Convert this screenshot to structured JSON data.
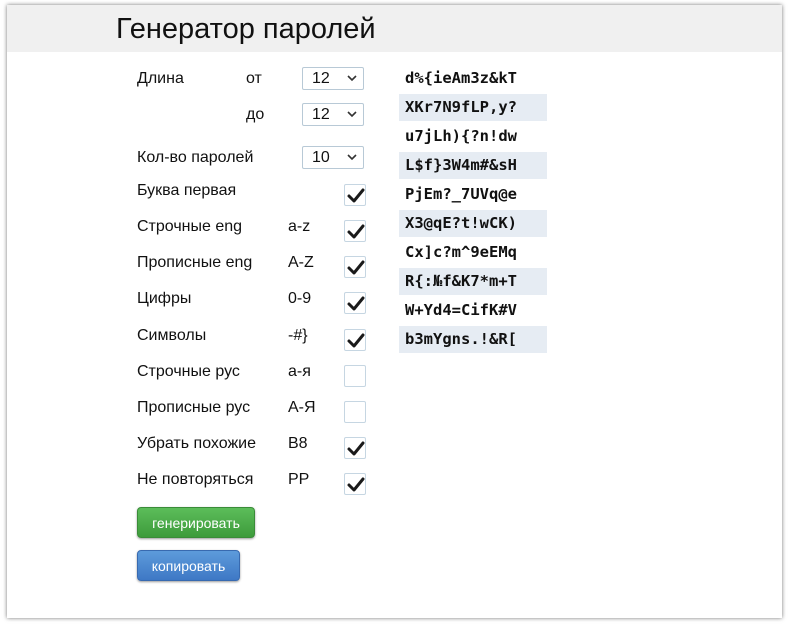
{
  "title": "Генератор паролей",
  "length": {
    "label": "Длина",
    "from_label": "от",
    "from_value": "12",
    "to_label": "до",
    "to_value": "12"
  },
  "count": {
    "label": "Кол-во паролей",
    "value": "10"
  },
  "options": [
    {
      "label": "Буква первая",
      "hint": "",
      "checked": true
    },
    {
      "label": "Строчные eng",
      "hint": "a-z",
      "checked": true
    },
    {
      "label": "Прописные eng",
      "hint": "A-Z",
      "checked": true
    },
    {
      "label": "Цифры",
      "hint": "0-9",
      "checked": true
    },
    {
      "label": "Символы",
      "hint": "-#}",
      "checked": true
    },
    {
      "label": "Строчные рус",
      "hint": "а-я",
      "checked": false
    },
    {
      "label": "Прописные рус",
      "hint": "А-Я",
      "checked": false
    },
    {
      "label": "Убрать похожие",
      "hint": "B8",
      "checked": true
    },
    {
      "label": "Не повторяться",
      "hint": "PP",
      "checked": true
    }
  ],
  "buttons": {
    "generate": "генерировать",
    "copy": "копировать"
  },
  "passwords": [
    "d%{ieAm3z&kT",
    "XKr7N9fLP,y?",
    "u7jLh){?n!dw",
    "L$f}3W4m#&sH",
    "PjEm?_7UVq@e",
    "X3@qE?t!wCK)",
    "Cx]c?m^9eEMq",
    "R{:№f&K7*m+T",
    "W+Yd4=CifK#V",
    "b3mYgns.!&R["
  ],
  "colors": {
    "header_bg": "#f0f0f0",
    "generate_btn": "#4cae4a",
    "copy_btn": "#4a88cf",
    "password_stripe": "#e6ecf3"
  }
}
